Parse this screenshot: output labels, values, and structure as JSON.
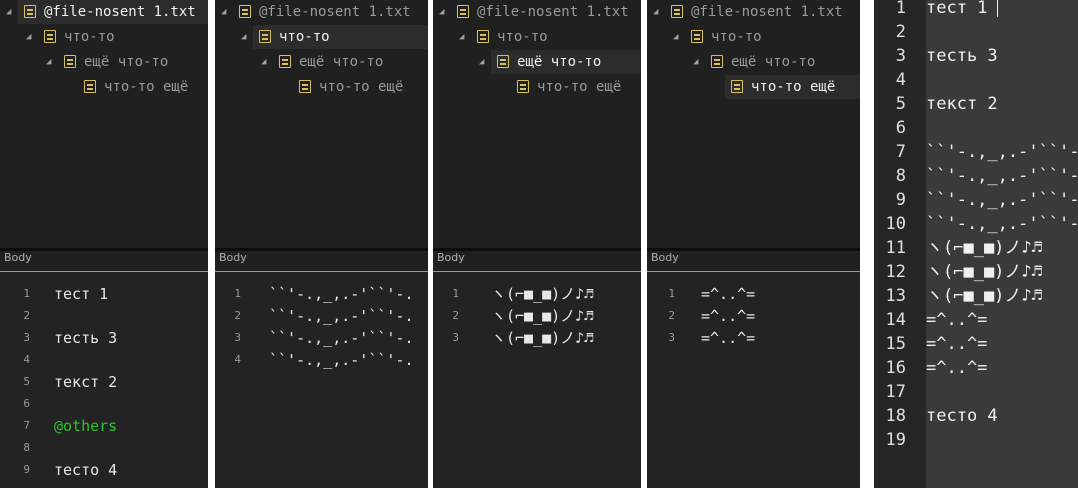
{
  "tree_common": {
    "root": "@file-nosent 1.txt",
    "child": "что-то",
    "grandchild": "ещё что-то",
    "leaf": "что-то ещё"
  },
  "body_label": "Body",
  "panes": [
    {
      "selected": "root",
      "lines": [
        {
          "n": "1",
          "t": "тест 1"
        },
        {
          "n": "2",
          "t": ""
        },
        {
          "n": "3",
          "t": "тесть 3"
        },
        {
          "n": "4",
          "t": ""
        },
        {
          "n": "5",
          "t": "текст 2"
        },
        {
          "n": "6",
          "t": ""
        },
        {
          "n": "7",
          "t": "@others",
          "green": true
        },
        {
          "n": "8",
          "t": ""
        },
        {
          "n": "9",
          "t": "тесто 4"
        }
      ]
    },
    {
      "selected": "child",
      "lines": [
        {
          "n": "1",
          "t": "``'-.,_,.-'``'-."
        },
        {
          "n": "2",
          "t": "``'-.,_,.-'``'-."
        },
        {
          "n": "3",
          "t": "``'-.,_,.-'``'-."
        },
        {
          "n": "4",
          "t": "``'-.,_,.-'``'-."
        }
      ]
    },
    {
      "selected": "grandchild",
      "lines": [
        {
          "n": "1",
          "t": "ヽ(⌐■_■)ノ♪♬"
        },
        {
          "n": "2",
          "t": "ヽ(⌐■_■)ノ♪♬"
        },
        {
          "n": "3",
          "t": "ヽ(⌐■_■)ノ♪♬"
        }
      ]
    },
    {
      "selected": "leaf",
      "lines": [
        {
          "n": "1",
          "t": "=^..^="
        },
        {
          "n": "2",
          "t": "=^..^="
        },
        {
          "n": "3",
          "t": "=^..^="
        }
      ]
    }
  ],
  "editor": {
    "lines": [
      {
        "n": "1",
        "t": "тест 1"
      },
      {
        "n": "2",
        "t": ""
      },
      {
        "n": "3",
        "t": "тесть 3"
      },
      {
        "n": "4",
        "t": ""
      },
      {
        "n": "5",
        "t": "текст 2"
      },
      {
        "n": "6",
        "t": ""
      },
      {
        "n": "7",
        "t": "``'-.,_,.-'``'-."
      },
      {
        "n": "8",
        "t": "``'-.,_,.-'``'-."
      },
      {
        "n": "9",
        "t": "``'-.,_,.-'``'-."
      },
      {
        "n": "10",
        "t": "``'-.,_,.-'``'-."
      },
      {
        "n": "11",
        "t": "ヽ(⌐■_■)ノ♪♬"
      },
      {
        "n": "12",
        "t": "ヽ(⌐■_■)ノ♪♬"
      },
      {
        "n": "13",
        "t": "ヽ(⌐■_■)ノ♪♬"
      },
      {
        "n": "14",
        "t": "=^..^="
      },
      {
        "n": "15",
        "t": "=^..^="
      },
      {
        "n": "16",
        "t": "=^..^="
      },
      {
        "n": "17",
        "t": ""
      },
      {
        "n": "18",
        "t": "тесто 4"
      },
      {
        "n": "19",
        "t": ""
      }
    ]
  }
}
